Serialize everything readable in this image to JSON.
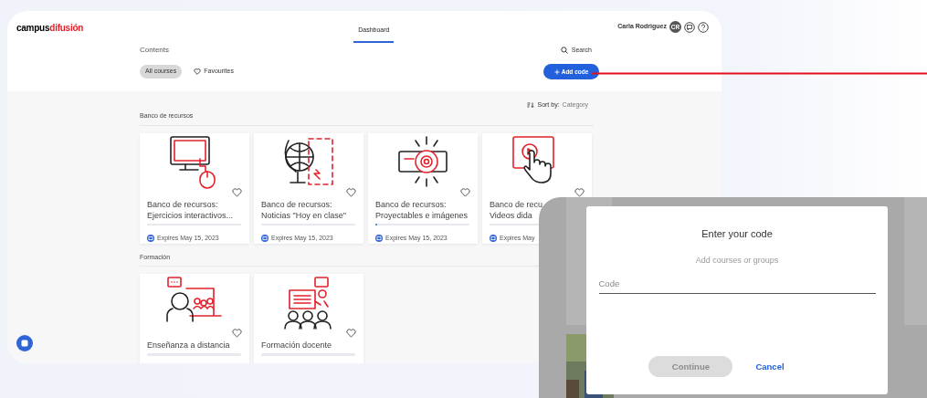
{
  "header": {
    "logo": {
      "first": "campus",
      "second": "difusión"
    },
    "tabs": [
      {
        "label": "Dashboard",
        "selected": true
      }
    ],
    "user": {
      "name": "Carla Rodriguez",
      "initials": "CR"
    }
  },
  "toolbar": {
    "title": "Contents",
    "search": "Search",
    "filters": [
      {
        "label": "All courses",
        "selected": true
      },
      {
        "label": "Favourites",
        "selected": false
      }
    ],
    "add_button": "Add code"
  },
  "sort": {
    "label": "Sort by:",
    "value": "Category"
  },
  "sections": [
    {
      "title": "Banco de recursos",
      "cards": [
        {
          "kind": "computer",
          "title_lines": [
            "Banco de recursos:",
            "Ejercicios interactivos..."
          ],
          "level": 0,
          "favourite": false,
          "expires": "Expires May 15, 2023"
        },
        {
          "kind": "globe",
          "title_lines": [
            "Banco de recursos:",
            "Noticias \"Hoy en clase\""
          ],
          "level": 0,
          "favourite": false,
          "expires": "Expires May 15, 2023"
        },
        {
          "kind": "projector",
          "title_lines": [
            "Banco de recursos:",
            "Proyectables e imágenes"
          ],
          "level": 0.02,
          "favourite": false,
          "expires": "Expires May 15, 2023"
        },
        {
          "kind": "touch",
          "title_lines": [
            "Banco de recu",
            "Videos dida"
          ],
          "level": 0,
          "favourite": false,
          "expires": "Expires May"
        }
      ]
    },
    {
      "title": "Formación",
      "cards": [
        {
          "kind": "remote",
          "title_lines": [
            "Enseñanza a distancia"
          ],
          "level": 0,
          "favourite": false
        },
        {
          "kind": "teacher",
          "title_lines": [
            "Formación docente"
          ],
          "level": 0,
          "favourite": false
        }
      ]
    }
  ],
  "modal": {
    "title": "Enter your code",
    "subtitle": "Add courses or groups",
    "field": {
      "placeholder": "Code"
    },
    "buttons": [
      {
        "label": "Continue",
        "kind": "primary",
        "disabled": true
      },
      {
        "label": "Cancel",
        "kind": "link",
        "disabled": false
      }
    ]
  }
}
